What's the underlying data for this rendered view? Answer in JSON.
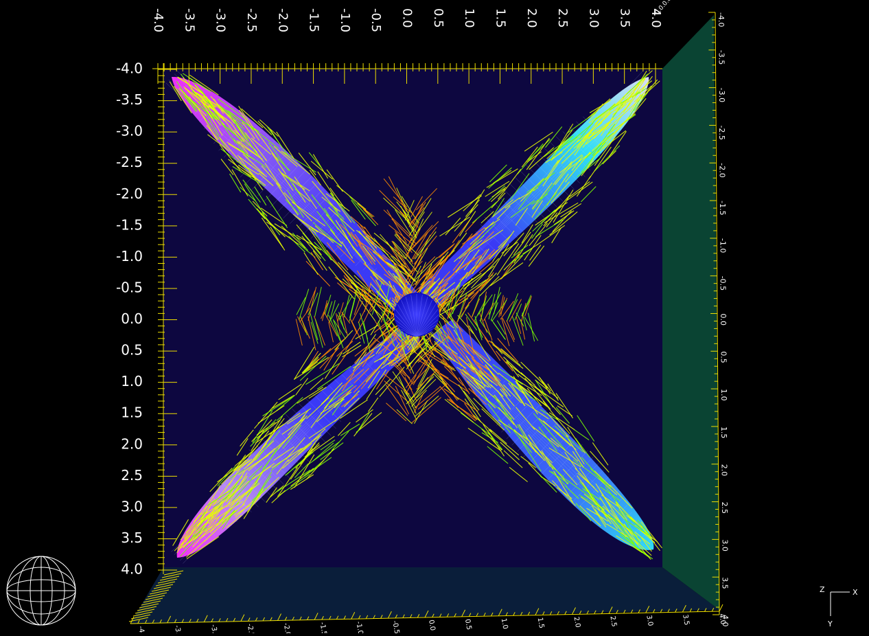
{
  "colors": {
    "background": "#000000",
    "plot_back_wall": "#0d0740",
    "side_wall": "#0a4433",
    "floor_wall": "#0a1e3a",
    "tick_color": "#f0e000",
    "label_color": "#ffffff",
    "surface_base": "#3c3cff",
    "surface_highlight": "#ff30ff",
    "surface_cyan": "#30e8ff",
    "vector_yellow": "#e8ff00",
    "vector_orange": "#ff8c00",
    "vector_green": "#7cff00",
    "center_sphere": "#2020ff"
  },
  "axes": {
    "top_x_ticks": [
      "-4.0",
      "-3.5",
      "-3.0",
      "-2.5",
      "-2.0",
      "-1.5",
      "-1.0",
      "-0.5",
      "0.0",
      "0.5",
      "1.0",
      "1.5",
      "2.0",
      "2.5",
      "3.0",
      "3.5",
      "4.0"
    ],
    "left_y_ticks": [
      "-4.0",
      "-3.5",
      "-3.0",
      "-2.5",
      "-2.0",
      "-1.5",
      "-1.0",
      "-0.5",
      "0.0",
      "0.5",
      "1.0",
      "1.5",
      "2.0",
      "2.5",
      "3.0",
      "3.5",
      "4.0"
    ],
    "right_z_ticks": [
      "-4.0",
      "-3.5",
      "-3.0",
      "-2.5",
      "-2.0",
      "-1.5",
      "-1.0",
      "-0.5",
      "0.0",
      "0.5",
      "1.0",
      "1.5",
      "2.0",
      "2.5",
      "3.0",
      "3.5",
      "4.0"
    ],
    "bottom_x_ticks": [
      "-4.0",
      "-3.5",
      "-3.0",
      "-2.5",
      "-2.0",
      "-1.5",
      "-1.0",
      "-0.5",
      "0.0",
      "0.5",
      "1.0",
      "1.5",
      "2.0",
      "2.5",
      "3.0",
      "3.5",
      "4.0"
    ]
  },
  "orientation_axes": {
    "x_label": "X",
    "y_label": "Y",
    "z_label": "Z"
  },
  "icons": {
    "trackball": "wireframe-sphere-icon",
    "axes_triad": "xyz-axes-icon"
  }
}
